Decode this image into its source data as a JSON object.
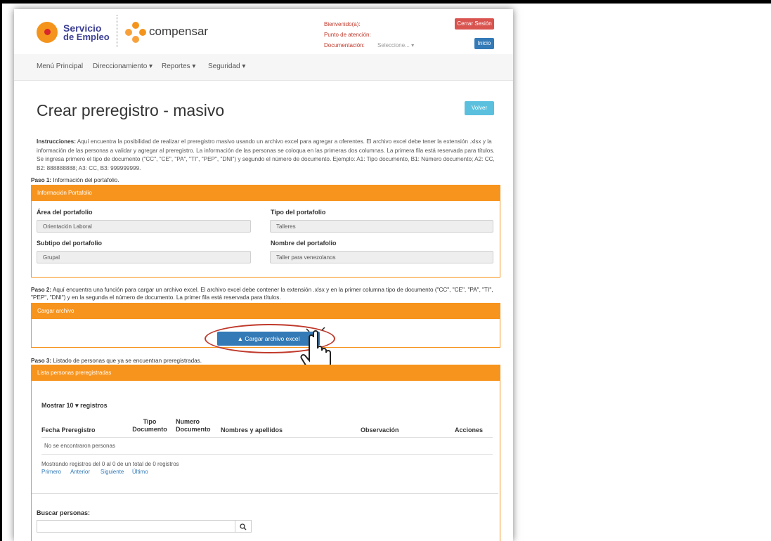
{
  "header": {
    "logo1_line1": "Servicio",
    "logo1_line2": "de Empleo",
    "logo2_text": "compensar",
    "bienvenido": "Bienvenido(a):",
    "punto": "Punto de atención:",
    "documentacion": "Documentación:",
    "documentacion_select": "Seleccione... ▾",
    "cerrar": "Cerrar Sesión",
    "inicio": "Inicio"
  },
  "nav": {
    "items": [
      "Menú Principal",
      "Direccionamiento ▾",
      "Reportes ▾",
      "Seguridad ▾"
    ]
  },
  "page": {
    "title": "Crear preregistro - masivo",
    "volver": "Volver",
    "instr_bold": "Instrucciones:",
    "instr_text": " Aquí encuentra la posibilidad de realizar el preregistro masivo usando un archivo excel para agregar a oferentes. El archivo excel debe tener la extensión .xlsx y la información de las personas a validar y agregar al preregistro. La información de las personas se coloqua en las primeras dos columnas. La primera fila está reservada para títulos. Se ingresa primero el tipo de documento (\"CC\", \"CE\", \"PA\", \"TI\", \"PEP\", \"DNI\") y segundo el número de documento. Ejemplo: A1: Tipo documento, B1: Número documento; A2: CC, B2: 888888888; A3: CC, B3: 999999999."
  },
  "paso1": {
    "bold": "Paso 1:",
    "text": " Información del portafolio.",
    "panel_title": "Información Portafolio",
    "area_label": "Área del portafolio",
    "area_value": "Orientación Laboral",
    "tipo_label": "Tipo del portafolio",
    "tipo_value": "Talleres",
    "subtipo_label": "Subtipo del portafolio",
    "subtipo_value": "Grupal",
    "nombre_label": "Nombre del portafolio",
    "nombre_value": "Taller para venezolanos"
  },
  "paso2": {
    "bold": "Paso 2:",
    "text": " Aquí encuentra una función para cargar un archivo excel. El archivo excel debe contener la extensión .xlsx y en la primer columna tipo de documento (\"CC\", \"CE\", \"PA\", \"TI\", \"PEP\", \"DNI\") y en la segunda el número de documento. La primer fila está reservada para títulos.",
    "panel_title": "Cargar archivo",
    "button": "Cargar archivo excel"
  },
  "paso3": {
    "bold": "Paso 3:",
    "text": " Listado de personas que ya se encuentran preregistradas.",
    "panel_title": "Lista personas preregistradas",
    "mostrar": "Mostrar",
    "mostrar_value": "10",
    "registros": "registros",
    "columns": [
      "Fecha Preregistro",
      "Tipo Documento",
      "Numero Documento",
      "Nombres y apellidos",
      "Observación",
      "Acciones"
    ],
    "empty": "No se encontraron personas",
    "info": "Mostrando registros del 0 al 0 de un total de 0 registros",
    "pagination": [
      "Primero",
      "Anterior",
      "Siguiente",
      "Último"
    ],
    "buscar_label": "Buscar personas:"
  }
}
